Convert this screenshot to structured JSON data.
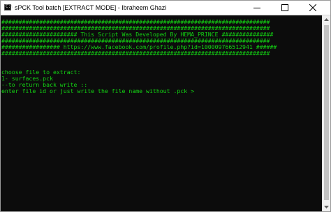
{
  "window": {
    "title": "sPCK Tool batch [EXTRACT MODE] - Ibraheem Ghazi",
    "app_icon_glyph": "C:\\",
    "icon": "console-window-icon",
    "controls": [
      "minimize-icon",
      "maximize-icon",
      "close-icon"
    ]
  },
  "console": {
    "text_color": "#13d313",
    "background": "#0c0c0c",
    "lines": [
      "##############################################################################",
      "##############################################################################",
      "###################### This Script Was Developed By HEMA_PRINCE ###############",
      "##############################################################################",
      "################# https://www.facebook.com/profile.php?id=100009766512941 ######",
      "##############################################################################",
      "",
      "",
      "choose file to extract:",
      "1- surfaces.pck",
      "--to return back write ::",
      "enter file id or just write the file name without .pck >"
    ]
  }
}
